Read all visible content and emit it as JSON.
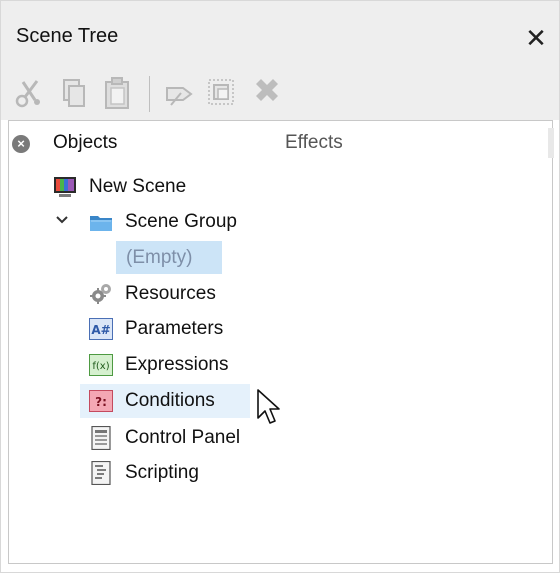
{
  "window": {
    "title": "Scene Tree",
    "close_glyph": "✕"
  },
  "toolbar": {
    "buttons": [
      {
        "name": "cut",
        "icon": "scissors-icon"
      },
      {
        "name": "copy",
        "icon": "copy-icon"
      },
      {
        "name": "paste",
        "icon": "paste-icon"
      },
      {
        "name": "rename",
        "icon": "tag-icon"
      },
      {
        "name": "duplicate",
        "icon": "duplicate-icon"
      },
      {
        "name": "delete",
        "icon": "delete-x-icon"
      }
    ]
  },
  "panel": {
    "close_glyph": "×",
    "tabs": [
      {
        "label": "Objects",
        "active": true
      },
      {
        "label": "Effects",
        "active": false
      }
    ]
  },
  "tree": {
    "root": {
      "label": "New Scene",
      "icon": "scene-monitor-icon"
    },
    "group": {
      "label": "Scene Group",
      "icon": "folder-icon",
      "expanded": true
    },
    "empty": {
      "label": "(Empty)"
    },
    "items": [
      {
        "label": "Resources",
        "icon": "gears-icon"
      },
      {
        "label": "Parameters",
        "icon": "parameters-icon",
        "badge": "A#"
      },
      {
        "label": "Expressions",
        "icon": "expressions-icon",
        "badge": "f(x)"
      },
      {
        "label": "Conditions",
        "icon": "conditions-icon",
        "badge": "?:",
        "hovered": true
      },
      {
        "label": "Control Panel",
        "icon": "control-panel-icon"
      },
      {
        "label": "Scripting",
        "icon": "script-icon"
      }
    ]
  },
  "colors": {
    "titlebar_bg": "#eeeeee",
    "selection_bg": "#cce4f7",
    "hover_bg": "#e5f1fb",
    "parameters_badge": "#2f5aa8",
    "expressions_badge": "#3a8a2f",
    "conditions_badge": "#e36a7e"
  }
}
